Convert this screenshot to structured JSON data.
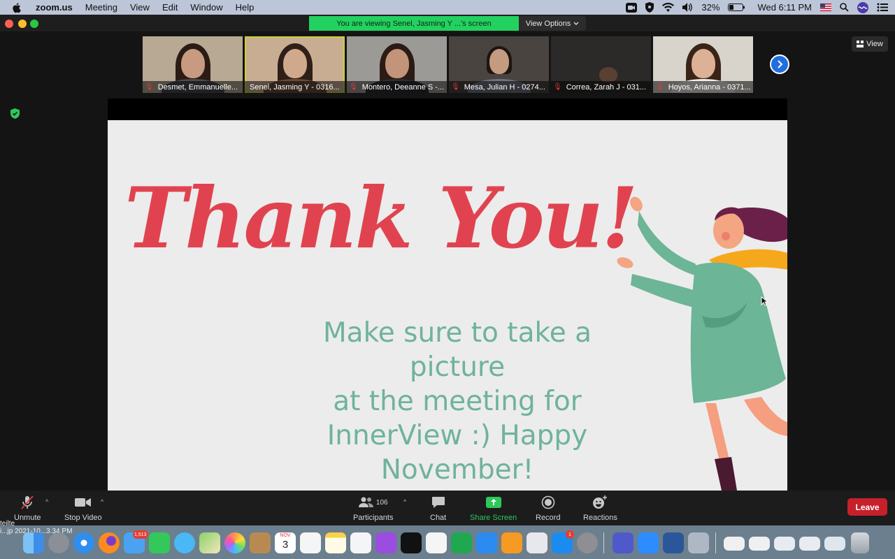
{
  "menubar": {
    "app_name": "zoom.us",
    "menus": [
      "Meeting",
      "View",
      "Edit",
      "Window",
      "Help"
    ],
    "battery": "32%",
    "clock": "Wed 6:11 PM"
  },
  "share_banner": {
    "text": "You are viewing Senel, Jasming Y ...'s screen",
    "view_options_label": "View Options"
  },
  "view_button_label": "View",
  "participants_strip": [
    {
      "name": "Desmet, Emmanuelle...",
      "muted": true
    },
    {
      "name": "Senel, Jasming Y - 0316...",
      "muted": false,
      "active": true
    },
    {
      "name": "Montero, Deeanne S -...",
      "muted": true
    },
    {
      "name": "Mesa, Julian H - 0274...",
      "muted": true
    },
    {
      "name": "Correa, Zarah J - 031...",
      "muted": true
    },
    {
      "name": "Hoyos, Arianna - 0371...",
      "muted": true
    }
  ],
  "slide": {
    "heading": "Thank You!",
    "message_lines": [
      "Make sure to take a picture",
      "at the meeting for",
      "InnerView :) Happy",
      "November!"
    ]
  },
  "toolbar": {
    "unmute_label": "Unmute",
    "stop_video_label": "Stop Video",
    "participants_label": "Participants",
    "participants_count": "106",
    "chat_label": "Chat",
    "share_screen_label": "Share Screen",
    "record_label": "Record",
    "reactions_label": "Reactions",
    "leave_label": "Leave"
  },
  "desktop_label": {
    "line1": "teilte",
    "line2": "i...jp   2021-10...3.34 PM"
  },
  "dock": {
    "calendar_month": "NOV",
    "calendar_day": "3",
    "badges": {
      "mail": "1,513",
      "appstore": "1"
    }
  },
  "colors": {
    "banner_green": "#23d160",
    "leave_red": "#c6202b",
    "slide_heading": "#e0434f",
    "slide_text": "#6fb39a",
    "active_outline": "#c9d236"
  }
}
